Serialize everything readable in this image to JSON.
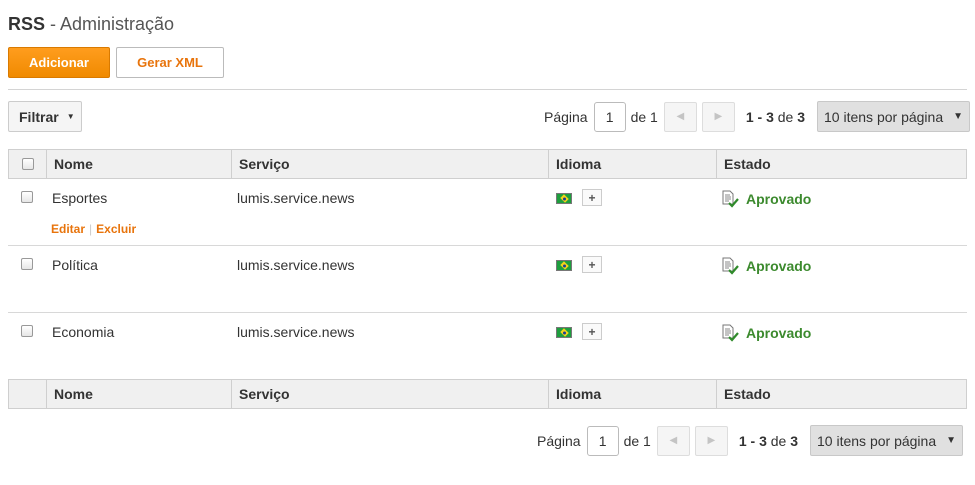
{
  "header": {
    "title_strong": "RSS",
    "title_rest": " - Administração"
  },
  "toolbar": {
    "add_label": "Adicionar",
    "xml_label": "Gerar XML"
  },
  "filter": {
    "label": "Filtrar"
  },
  "pagination": {
    "page_label": "Página",
    "current_page": "1",
    "of_label": "de 1",
    "range": "1 - 3",
    "range_of": "de",
    "total": "3",
    "per_page": "10 itens por página"
  },
  "table": {
    "columns": [
      "Nome",
      "Serviço",
      "Idioma",
      "Estado"
    ],
    "rows": [
      {
        "name": "Esportes",
        "service": "lumis.service.news",
        "status": "Aprovado",
        "edit": "Editar",
        "delete": "Excluir",
        "show_actions": true
      },
      {
        "name": "Política",
        "service": "lumis.service.news",
        "status": "Aprovado"
      },
      {
        "name": "Economia",
        "service": "lumis.service.news",
        "status": "Aprovado"
      }
    ]
  },
  "icons": {
    "language_flag": "brazil-flag-icon",
    "add_language": "plus-icon",
    "status": "document-check-icon",
    "prev": "chevron-left-icon",
    "next": "chevron-right-icon"
  },
  "colors": {
    "primary": "#f08a00",
    "link": "#e8740c",
    "approved": "#3c8a2e"
  }
}
